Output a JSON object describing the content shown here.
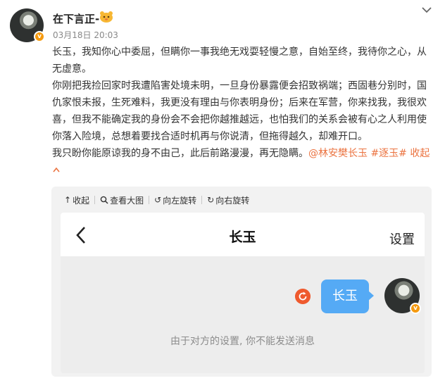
{
  "post": {
    "author": "在下言正-",
    "time": "03月18日 20:03",
    "paragraphs": [
      "长玉，我知你心中委屈，但瞒你一事我绝无戏耍轻慢之意，自始至终，我待你之心，从无虚意。",
      "你刚把我捡回家时我遭陷害处境未明，一旦身份暴露便会招致祸端；西固巷分别时，国仇家恨未报，生死难料，我更没有理由与你表明身份；后来在军营，你来找我，我很欢喜，但我不能确定我的身份会不会把你越推越远，也怕我们的关系会被有心之人利用使你落入险境，总想着要找合适时机再与你说清，但拖得越久，却难开口。"
    ],
    "last_line": "我只盼你能原谅我的身不由己，此后前路漫漫，再无隐瞒。",
    "mention": "@林安樊长玉",
    "topic": "#逐玉#",
    "collapse_label": "收起"
  },
  "toolbar": {
    "collapse": "收起",
    "view_large": "查看大图",
    "rotate_left": "向左旋转",
    "rotate_right": "向右旋转"
  },
  "chat": {
    "title": "长玉",
    "settings": "设置",
    "message": "长玉",
    "notice": "由于对方的设置, 你不能发送消息"
  },
  "colors": {
    "link": "#eb7340",
    "bubble": "#55aaf5",
    "badge": "#f59a0f",
    "retry": "#ef5a2e"
  }
}
